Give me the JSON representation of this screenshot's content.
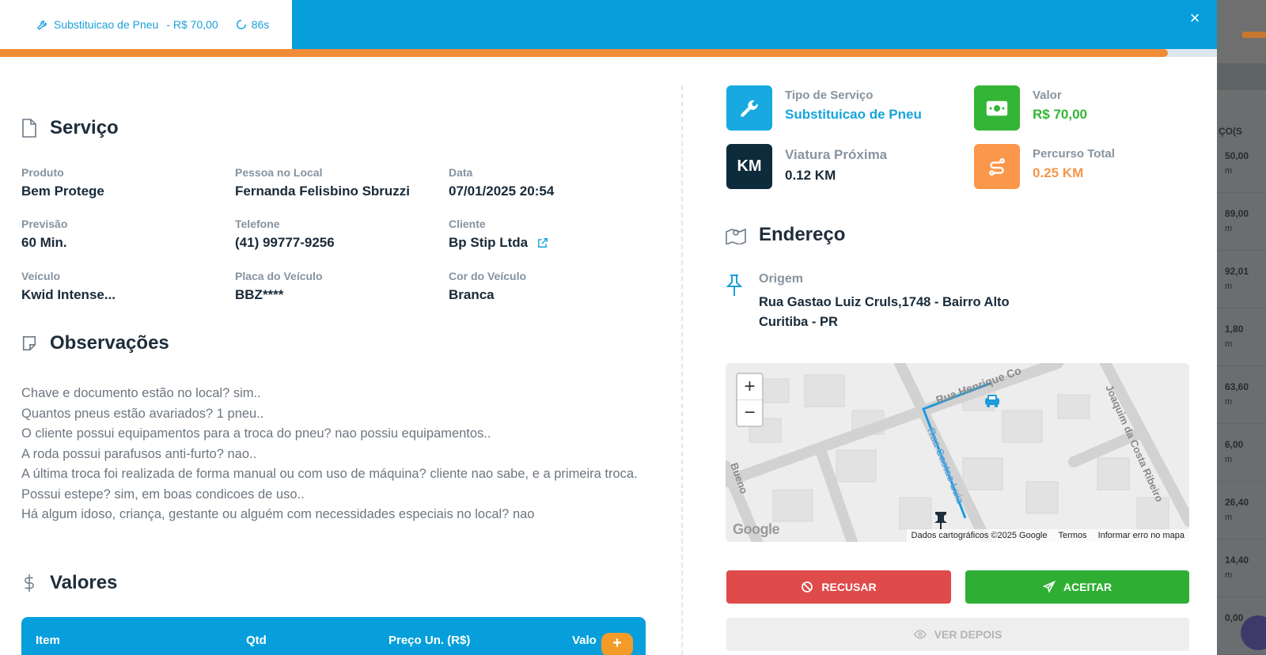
{
  "header": {
    "service_name": "Substituicao de Pneu",
    "price": "- R$ 70,00",
    "timer": "86s",
    "close_label": "×",
    "progress_percent": 96
  },
  "servico": {
    "title": "Serviço",
    "fields": {
      "produto": {
        "label": "Produto",
        "value": "Bem Protege"
      },
      "pessoa": {
        "label": "Pessoa no Local",
        "value": "Fernanda Felisbino Sbruzzi"
      },
      "data": {
        "label": "Data",
        "value": "07/01/2025 20:54"
      },
      "previsao": {
        "label": "Previsão",
        "value": "60 Min."
      },
      "telefone": {
        "label": "Telefone",
        "value": "(41) 99777-9256"
      },
      "cliente": {
        "label": "Cliente",
        "value": "Bp Stip Ltda"
      },
      "veiculo": {
        "label": "Veículo",
        "value": "Kwid Intense..."
      },
      "placa": {
        "label": "Placa do Veículo",
        "value": "BBZ****"
      },
      "cor": {
        "label": "Cor do Veículo",
        "value": "Branca"
      }
    }
  },
  "observacoes": {
    "title": "Observações",
    "lines": [
      "Chave e documento estão no local? sim..",
      "Quantos pneus estão avariados? 1 pneu..",
      "O cliente possui equipamentos para a troca do pneu? nao possiu equipamentos..",
      "A roda possui parafusos anti-furto? nao..",
      "A última troca foi realizada de forma manual ou com uso de máquina? cliente nao sabe, e a primeira troca.",
      "Possui estepe? sim, em boas condicoes de uso..",
      "Há algum idoso, criança, gestante ou alguém com necessidades especiais no local? nao"
    ]
  },
  "valores": {
    "title": "Valores",
    "columns": [
      "Item",
      "Qtd",
      "Preço Un. (R$)",
      "Valo"
    ],
    "add_label": "+"
  },
  "stats": {
    "tipo": {
      "label": "Tipo de Serviço",
      "value": "Substituicao de Pneu",
      "color": "#17a3dc",
      "icon": "wrench-icon"
    },
    "valor": {
      "label": "Valor",
      "value": "R$ 70,00",
      "color": "#33b535",
      "icon": "money-icon"
    },
    "viatura": {
      "label": "Viatura Próxima",
      "value": "0.12 KM",
      "color": "#182a39",
      "icon": "km-icon",
      "icon_text": "KM"
    },
    "percurso": {
      "label": "Percurso Total",
      "value": "0.25 KM",
      "color": "#f7954a",
      "icon": "route-icon"
    }
  },
  "endereco": {
    "title": "Endereço",
    "origem_label": "Origem",
    "line1": "Rua Gastao Luiz Cruls,1748 - Bairro Alto",
    "line2": "Curitiba - PR"
  },
  "map": {
    "zoom_in": "+",
    "zoom_out": "−",
    "google": "Google",
    "attribution": "Dados cartográficos ©2025 Google",
    "terms": "Termos",
    "report": "Informar erro no mapa",
    "street1": "Rua Henrique Co",
    "street2": "Joaquim da Costa Ribeiro",
    "street3": "Rua Gastao Luiz",
    "street4": "Bueno"
  },
  "actions": {
    "reject": "RECUSAR",
    "accept": "ACEITAR",
    "later": "VER DEPOIS"
  },
  "background": {
    "column_head": "ÇO(S",
    "rows": [
      {
        "value": "50,00",
        "unit": "m"
      },
      {
        "value": "89,00",
        "unit": "m"
      },
      {
        "value": "92,01",
        "unit": "m"
      },
      {
        "value": "1,80",
        "unit": "m"
      },
      {
        "value": "63,60",
        "unit": "m"
      },
      {
        "value": "6,00",
        "unit": "m"
      },
      {
        "value": "26,40",
        "unit": "m"
      },
      {
        "value": "14,40",
        "unit": "m"
      },
      {
        "value": "0,00",
        "unit": ""
      }
    ]
  }
}
